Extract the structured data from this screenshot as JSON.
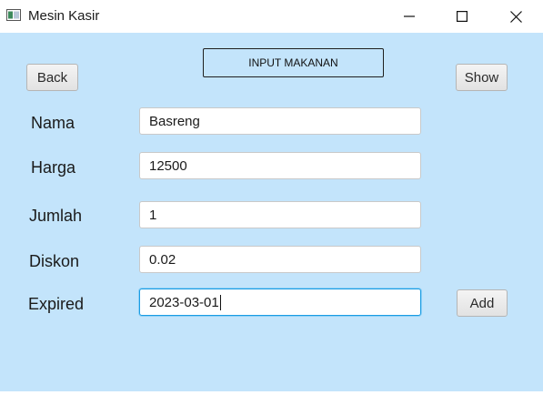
{
  "window": {
    "title": "Mesin Kasir",
    "controls": {
      "minimize": "minimize-icon",
      "maximize": "maximize-icon",
      "close": "close-icon"
    }
  },
  "header": {
    "title": "INPUT MAKANAN"
  },
  "buttons": {
    "back": "Back",
    "show": "Show",
    "add": "Add"
  },
  "form": {
    "nama": {
      "label": "Nama",
      "value": "Basreng"
    },
    "harga": {
      "label": "Harga",
      "value": "12500"
    },
    "jumlah": {
      "label": "Jumlah",
      "value": "1"
    },
    "diskon": {
      "label": "Diskon",
      "value": "0.02"
    },
    "expired": {
      "label": "Expired",
      "value": "2023-03-01"
    }
  },
  "colors": {
    "background": "#c3e4fb",
    "focus_border": "#1a9ce3"
  }
}
